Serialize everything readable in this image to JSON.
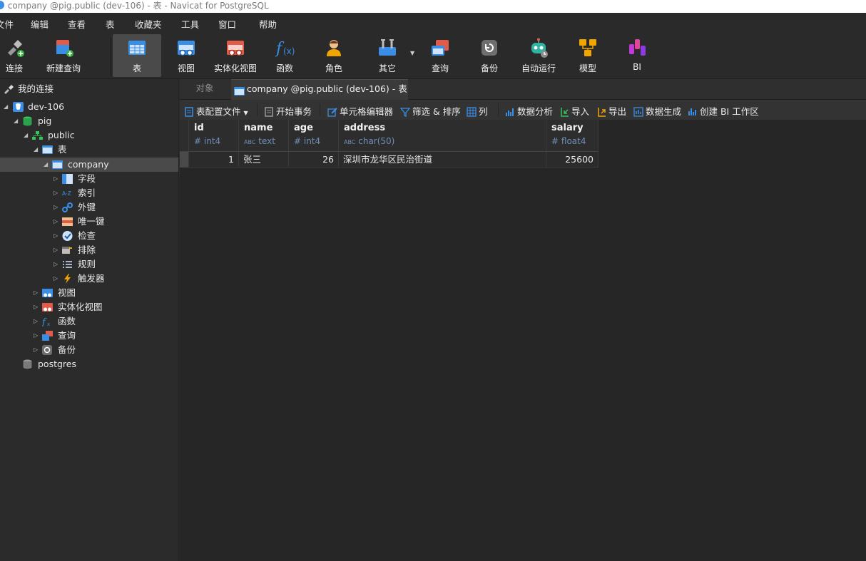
{
  "window": {
    "title": "company @pig.public (dev-106) - 表 - Navicat for PostgreSQL"
  },
  "menu": [
    "文件",
    "编辑",
    "查看",
    "表",
    "收藏夹",
    "工具",
    "窗口",
    "帮助"
  ],
  "toolbar": [
    {
      "label": "连接",
      "icon": "connection-icon"
    },
    {
      "label": "新建查询",
      "icon": "new-query-icon"
    },
    {
      "label": "表",
      "icon": "table-icon",
      "active": true
    },
    {
      "label": "视图",
      "icon": "view-icon"
    },
    {
      "label": "实体化视图",
      "icon": "materialized-view-icon"
    },
    {
      "label": "函数",
      "icon": "function-icon"
    },
    {
      "label": "角色",
      "icon": "role-icon"
    },
    {
      "label": "其它",
      "icon": "others-icon"
    },
    {
      "label": "查询",
      "icon": "query-icon"
    },
    {
      "label": "备份",
      "icon": "backup-icon"
    },
    {
      "label": "自动运行",
      "icon": "automation-icon"
    },
    {
      "label": "模型",
      "icon": "model-icon"
    },
    {
      "label": "BI",
      "icon": "bi-icon"
    }
  ],
  "sidebar": {
    "header": "我的连接",
    "tree": {
      "connection": "dev-106",
      "database": "pig",
      "schema": "public",
      "tables_folder": "表",
      "table": "company",
      "table_children": [
        "字段",
        "索引",
        "外键",
        "唯一键",
        "检查",
        "排除",
        "规则",
        "触发器"
      ],
      "schema_children": [
        "视图",
        "实体化视图",
        "函数",
        "查询",
        "备份"
      ],
      "other_database": "postgres"
    }
  },
  "tabs": {
    "objects": "对象",
    "active": "company @pig.public (dev-106) - 表"
  },
  "table_toolbar": {
    "config": "表配置文件",
    "begin_tx": "开始事务",
    "cell_editor": "单元格编辑器",
    "filter_sort": "筛选 & 排序",
    "columns": "列",
    "analysis": "数据分析",
    "import": "导入",
    "export": "导出",
    "generate": "数据生成",
    "bi": "创建 BI 工作区"
  },
  "grid": {
    "columns": [
      {
        "name": "id",
        "type": "int4",
        "type_prefix": "#"
      },
      {
        "name": "name",
        "type": "text",
        "type_prefix": "ABC"
      },
      {
        "name": "age",
        "type": "int4",
        "type_prefix": "#"
      },
      {
        "name": "address",
        "type": "char(50)",
        "type_prefix": "ABC"
      },
      {
        "name": "salary",
        "type": "float4",
        "type_prefix": "#"
      }
    ],
    "rows": [
      [
        "1",
        "张三",
        "26",
        "深圳市龙华区民治街道",
        "25600"
      ]
    ]
  },
  "colors": {
    "background": "#2b2b2b",
    "accent": "#3d8ee6",
    "selected": "#4a4a4a"
  }
}
